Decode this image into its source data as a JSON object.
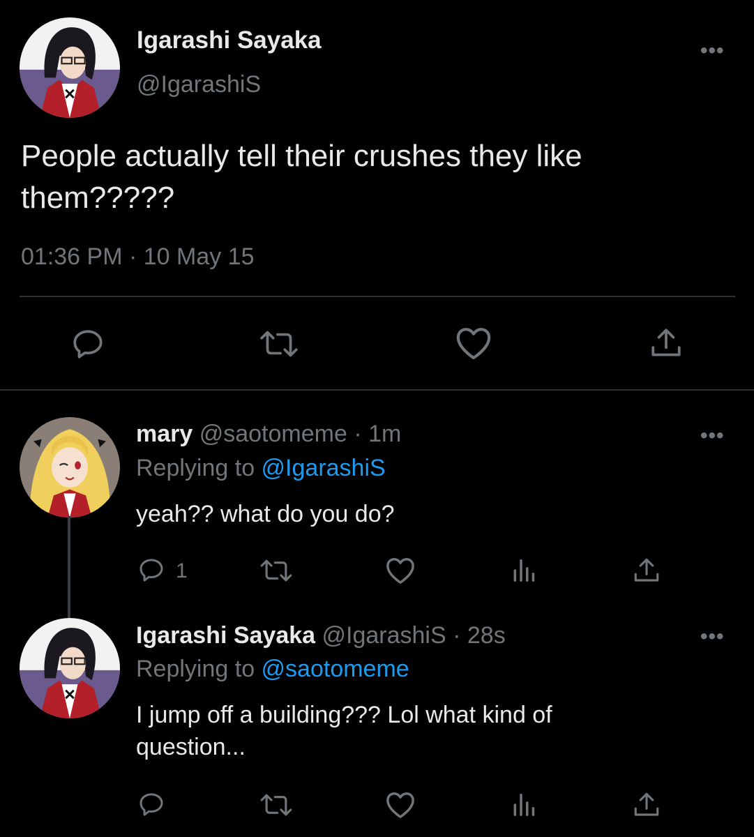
{
  "main_tweet": {
    "name": "Igarashi Sayaka",
    "handle": "@IgarashiS",
    "text": "People actually tell their crushes they like them?????",
    "timestamp": "01:36 PM · 10 May 15",
    "more": "•••"
  },
  "reply1": {
    "name": "mary",
    "meta": " @saotomeme · 1m",
    "replying_prefix": "Replying to ",
    "replying_handle": "@IgarashiS",
    "text": "yeah?? what do you do?",
    "reply_count": "1",
    "more": "•••"
  },
  "reply2": {
    "name": "Igarashi Sayaka",
    "meta": " @IgarashiS · 28s",
    "replying_prefix": "Replying to ",
    "replying_handle": "@saotomeme",
    "text": "I jump off a building??? Lol what kind of question...",
    "more": "•••"
  },
  "colors": {
    "background": "#000000",
    "text": "#e7e9ea",
    "secondary": "#71767b",
    "link": "#1d9bf0",
    "divider": "#2f3336"
  },
  "icons": [
    "reply-icon",
    "retweet-icon",
    "like-icon",
    "share-icon",
    "analytics-icon",
    "more-icon"
  ]
}
